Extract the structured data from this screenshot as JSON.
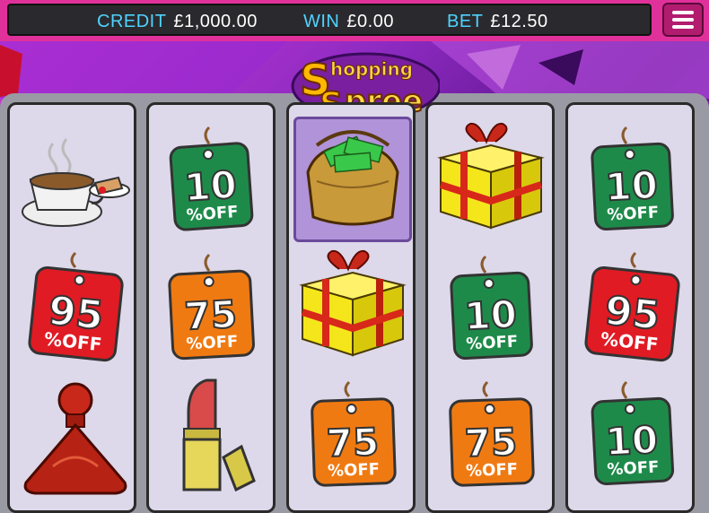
{
  "hud": {
    "credit_label": "CREDIT",
    "credit_value": "£1,000.00",
    "win_label": "WIN",
    "win_value": "£0.00",
    "bet_label": "BET",
    "bet_value": "£12.50"
  },
  "menu": {
    "icon": "hamburger-menu-icon"
  },
  "logo": {
    "line1": "hopping",
    "line2": "pree",
    "initial1": "S",
    "initial2": "S"
  },
  "tags": {
    "ten": "10",
    "seventyfive": "75",
    "ninetyfive": "95",
    "off": "%OFF"
  },
  "reels": [
    [
      "coffee-cake-icon",
      "95-off-tag-icon",
      "perfume-bottle-icon"
    ],
    [
      "10-off-tag-icon",
      "75-off-tag-icon",
      "lipstick-icon"
    ],
    [
      "money-bag-icon",
      "gift-box-icon",
      "75-off-tag-icon"
    ],
    [
      "gift-box-icon",
      "10-off-tag-icon",
      "75-off-tag-icon"
    ],
    [
      "10-off-tag-icon",
      "95-off-tag-icon",
      "10-off-tag-icon"
    ]
  ],
  "colors": {
    "topbar": "#e0319a",
    "hud_label": "#4fd3ff",
    "tag_green": "#1e8a4a",
    "tag_orange": "#f07a12",
    "tag_red": "#e01b24",
    "gift_yellow": "#f5e61c"
  }
}
